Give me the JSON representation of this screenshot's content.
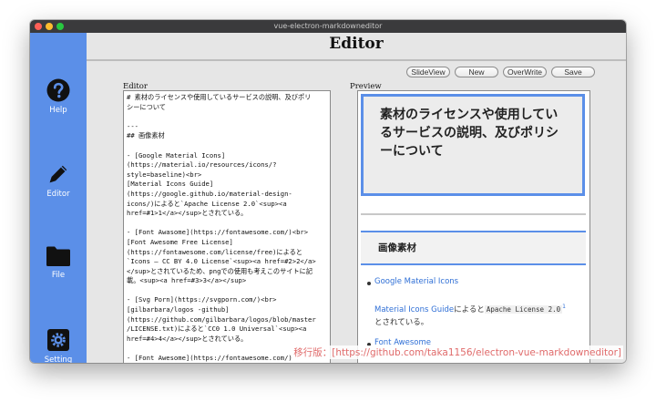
{
  "window": {
    "title": "vue-electron-markdowneditor"
  },
  "sidebar": {
    "items": [
      {
        "label": "Help"
      },
      {
        "label": "Editor"
      },
      {
        "label": "File"
      },
      {
        "label": "Setting"
      }
    ]
  },
  "header": {
    "title": "Editor"
  },
  "toolbar": {
    "slideview_label": "SlideView",
    "new_label": "New",
    "overwrite_label": "OverWrite",
    "save_label": "Save"
  },
  "editor": {
    "label": "Editor",
    "lines": [
      "# 素材のライセンスや使用しているサービスの説明、及びポリ",
      "シーについて",
      "",
      "---",
      "## 画像素材",
      "",
      "- [Google Material Icons]",
      "(https://material.io/resources/icons/?",
      "style=baseline)<br>",
      "[Material Icons Guide]",
      "(https://google.github.io/material-design-",
      "icons/)によると`Apache License 2.0`<sup><a",
      "href=#1>1</a></sup>とされている。",
      "",
      "- [Font Awasome](https://fontawesome.com/)<br>",
      "[Font Awesome Free License]",
      "(https://fontawesome.com/license/free)によると",
      "`Icons — CC BY 4.0 License`<sup><a href=#2>2</a>",
      "</sup>とされているため、pngでの使用も考えこのサイトに記",
      "載。<sup><a href=#3>3</a></sup>",
      "",
      "- [Svg Porn](https://svgporn.com/)<br>",
      "[gilbarbara/logos -github]",
      "(https://github.com/gilbarbara/logos/blob/master",
      "/LICENSE.txt)によると`CC0 1.0 Universal`<sup><a",
      "href=#4>4</a></sup>とされている。",
      "",
      "- [Font Awesome](https://fontawesome.com/)"
    ]
  },
  "preview": {
    "label": "Preview",
    "hero_title": "素材のライセンスや使用しているサービスの説明、及びポリシーについて",
    "section_title": "画像素材",
    "item1_link": "Google Material Icons",
    "item1_guide_link": "Material Icons Guide",
    "item1_mid": "によると",
    "item1_code": "Apache License 2.0",
    "item1_sup": "1",
    "item1_end": "とされている。",
    "item2_link": "Font Awesome"
  },
  "footer": {
    "note": "移行版：[https://github.com/taka1156/electron-vue-markdowneditor]"
  },
  "colors": {
    "accent": "#5b8fe8",
    "link": "#2f6fd6",
    "note": "#e06a6a"
  },
  "icons": [
    "help-icon",
    "pencil-icon",
    "folder-icon",
    "gear-icon"
  ]
}
